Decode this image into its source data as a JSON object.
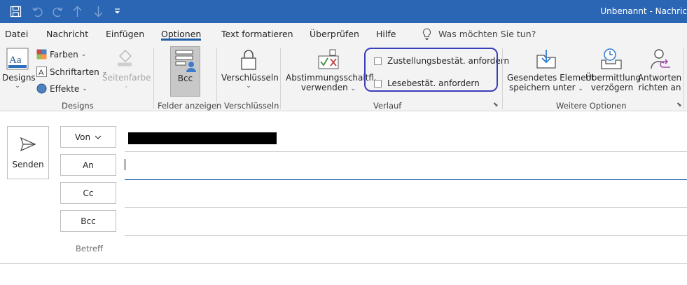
{
  "window": {
    "title": "Unbenannt  -  Nachric"
  },
  "quick_access": [
    "save-icon",
    "undo-icon",
    "redo-icon",
    "up-icon",
    "down-icon",
    "customize-icon"
  ],
  "tabs": [
    {
      "label": "Datei"
    },
    {
      "label": "Nachricht"
    },
    {
      "label": "Einfügen"
    },
    {
      "label": "Optionen",
      "active": true
    },
    {
      "label": "Text formatieren"
    },
    {
      "label": "Überprüfen"
    },
    {
      "label": "Hilfe"
    }
  ],
  "tell_me": {
    "placeholder": "Was möchten Sie tun?"
  },
  "ribbon": {
    "designs": {
      "designs_label": "Designs",
      "farben_label": "Farben",
      "schriftarten_label": "Schriftarten",
      "effekte_label": "Effekte",
      "seitenfarbe_label": "Seitenfarbe",
      "group_label": "Designs"
    },
    "felder": {
      "bcc_label": "Bcc",
      "group_label": "Felder anzeigen"
    },
    "verschluesseln": {
      "button_label": "Verschlüsseln",
      "group_label": "Verschlüsseln"
    },
    "verlauf": {
      "abstimmung_line1": "Abstimmungsschaltfl.",
      "abstimmung_line2": "verwenden",
      "zustellung_label": "Zustellungsbestät. anfordern",
      "lesebest_label": "Lesebestät. anfordern",
      "group_label": "Verlauf"
    },
    "weitere": {
      "gesendet_line1": "Gesendetes Element",
      "gesendet_line2": "speichern unter",
      "uebermittlung_line1": "Übermittlung",
      "uebermittlung_line2": "verzögern",
      "antworten_line1": "Antworten",
      "antworten_line2": "richten an",
      "group_label": "Weitere Optionen"
    }
  },
  "compose": {
    "send_label": "Senden",
    "von_label": "Von",
    "an_label": "An",
    "cc_label": "Cc",
    "bcc_label": "Bcc",
    "betreff_label": "Betreff"
  },
  "colors": {
    "titlebar": "#2b66b4",
    "accent": "#1e5fa7",
    "highlight": "#3a3eb8"
  }
}
